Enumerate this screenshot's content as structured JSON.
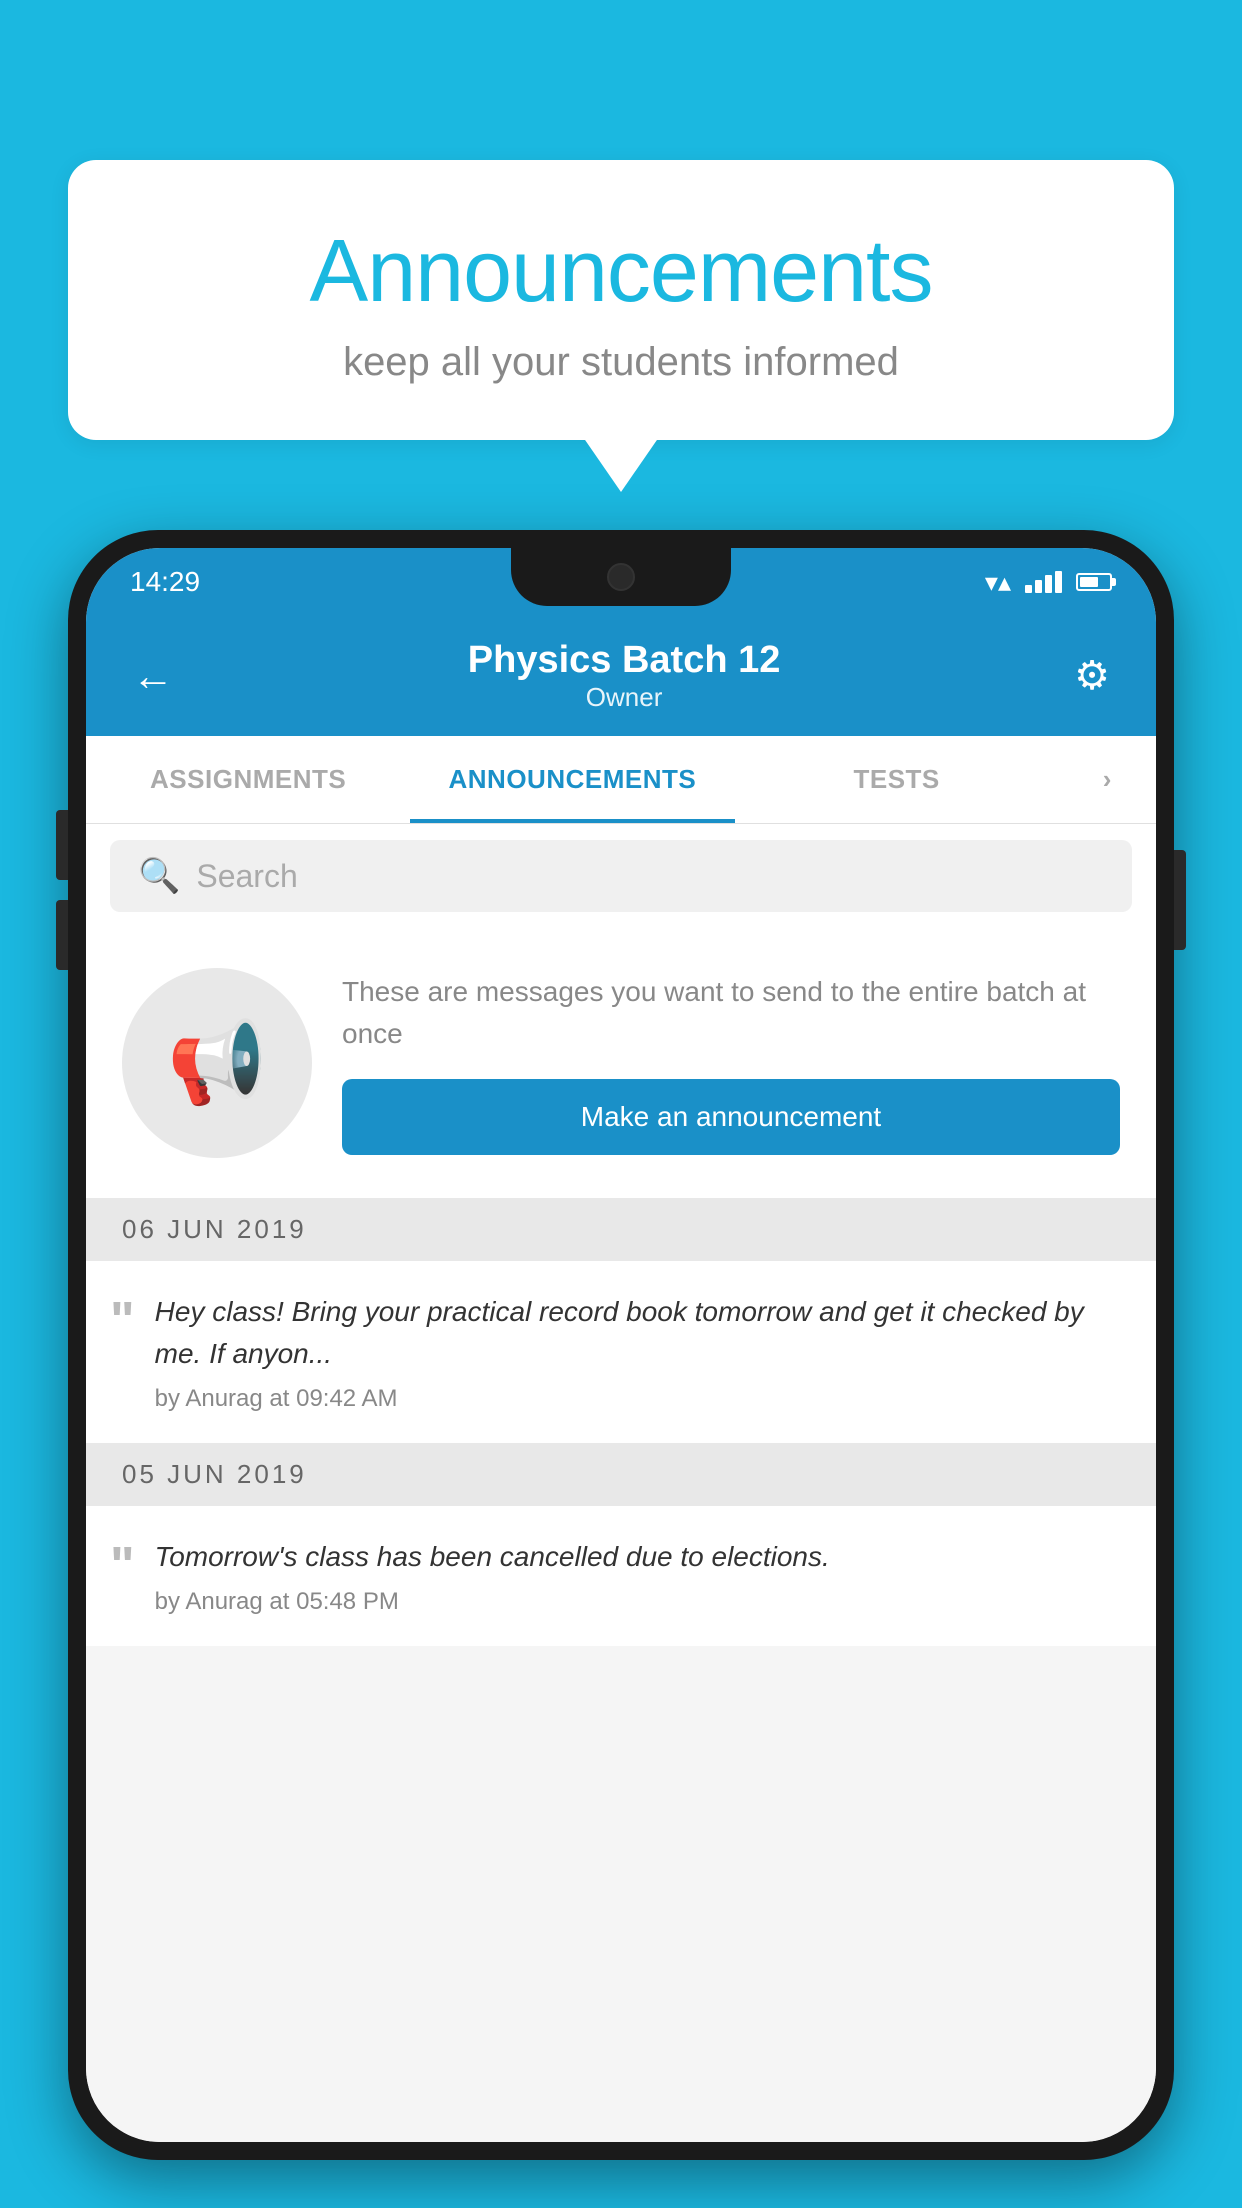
{
  "background": {
    "color": "#1BB8E0"
  },
  "speech_bubble": {
    "title": "Announcements",
    "subtitle": "keep all your students informed"
  },
  "status_bar": {
    "time": "14:29"
  },
  "app_bar": {
    "title": "Physics Batch 12",
    "subtitle": "Owner",
    "back_label": "←",
    "settings_label": "⚙"
  },
  "tabs": [
    {
      "label": "ASSIGNMENTS",
      "active": false
    },
    {
      "label": "ANNOUNCEMENTS",
      "active": true
    },
    {
      "label": "TESTS",
      "active": false
    },
    {
      "label": "›",
      "active": false
    }
  ],
  "search": {
    "placeholder": "Search"
  },
  "promo": {
    "description": "These are messages you want to send to the entire batch at once",
    "button_label": "Make an announcement"
  },
  "announcements": [
    {
      "date": "06  JUN  2019",
      "items": [
        {
          "text": "Hey class! Bring your practical record book tomorrow and get it checked by me. If anyon...",
          "author": "by Anurag at 09:42 AM"
        }
      ]
    },
    {
      "date": "05  JUN  2019",
      "items": [
        {
          "text": "Tomorrow's class has been cancelled due to elections.",
          "author": "by Anurag at 05:48 PM"
        }
      ]
    }
  ]
}
